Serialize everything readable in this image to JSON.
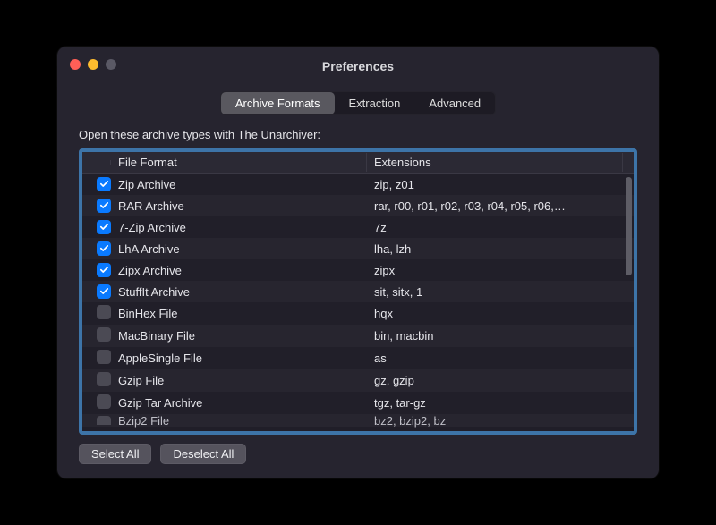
{
  "window_title": "Preferences",
  "tabs": [
    {
      "label": "Archive Formats",
      "active": true
    },
    {
      "label": "Extraction",
      "active": false
    },
    {
      "label": "Advanced",
      "active": false
    }
  ],
  "instruction": "Open these archive types with The Unarchiver:",
  "columns": {
    "c1": "File Format",
    "c2": "Extensions"
  },
  "rows": [
    {
      "checked": true,
      "format": "Zip Archive",
      "ext": "zip, z01"
    },
    {
      "checked": true,
      "format": "RAR Archive",
      "ext": "rar, r00, r01, r02, r03, r04, r05, r06,…"
    },
    {
      "checked": true,
      "format": "7-Zip Archive",
      "ext": "7z"
    },
    {
      "checked": true,
      "format": "LhA Archive",
      "ext": "lha, lzh"
    },
    {
      "checked": true,
      "format": "Zipx Archive",
      "ext": "zipx"
    },
    {
      "checked": true,
      "format": "StuffIt Archive",
      "ext": "sit, sitx, 1"
    },
    {
      "checked": false,
      "format": "BinHex File",
      "ext": "hqx"
    },
    {
      "checked": false,
      "format": "MacBinary File",
      "ext": "bin, macbin"
    },
    {
      "checked": false,
      "format": "AppleSingle File",
      "ext": "as"
    },
    {
      "checked": false,
      "format": "Gzip File",
      "ext": "gz, gzip"
    },
    {
      "checked": false,
      "format": "Gzip Tar Archive",
      "ext": "tgz, tar-gz"
    },
    {
      "checked": false,
      "format": "Bzip2 File",
      "ext": "bz2, bzip2, bz"
    }
  ],
  "buttons": {
    "select_all": "Select All",
    "deselect_all": "Deselect All"
  }
}
